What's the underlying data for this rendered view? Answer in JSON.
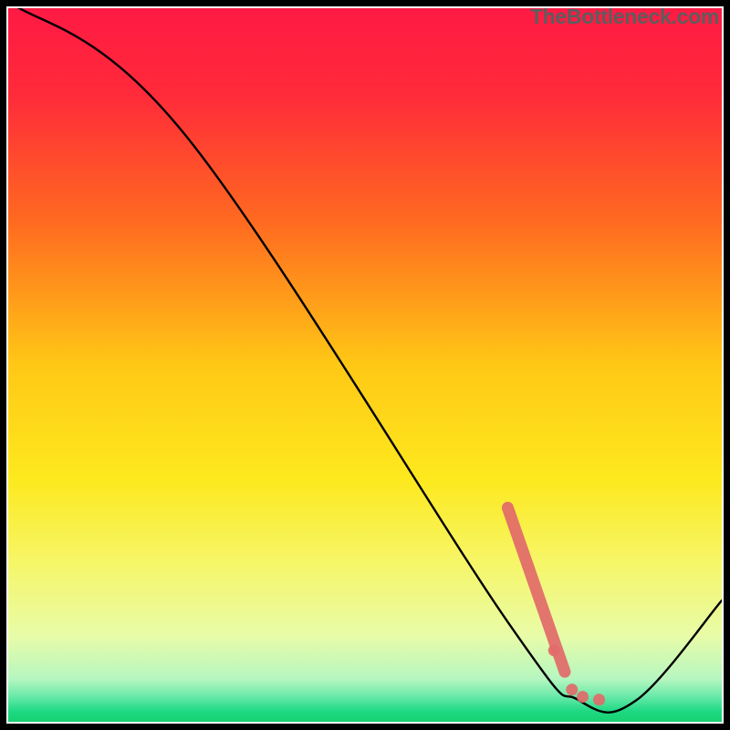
{
  "watermark": "TheBottleneck.com",
  "chart_data": {
    "type": "line",
    "title": "",
    "xlabel": "",
    "ylabel": "",
    "xlim": [
      0,
      100
    ],
    "ylim": [
      0,
      100
    ],
    "curve": [
      {
        "x": 0,
        "y": 101
      },
      {
        "x": 25,
        "y": 82
      },
      {
        "x": 70,
        "y": 14
      },
      {
        "x": 80,
        "y": 3
      },
      {
        "x": 88,
        "y": 3
      },
      {
        "x": 100,
        "y": 17
      }
    ],
    "highlight_segments": [
      {
        "x1": 70,
        "y1": 30,
        "x2": 78,
        "y2": 7
      }
    ],
    "highlight_points": [
      {
        "x": 76.5,
        "y": 10
      },
      {
        "x": 79,
        "y": 4.5
      },
      {
        "x": 80.5,
        "y": 3.5
      },
      {
        "x": 82.8,
        "y": 3.1
      }
    ],
    "gradient_stops": [
      {
        "offset": 0.0,
        "color": "#ff1a44"
      },
      {
        "offset": 0.12,
        "color": "#ff2a3a"
      },
      {
        "offset": 0.3,
        "color": "#ff6a20"
      },
      {
        "offset": 0.5,
        "color": "#ffc815"
      },
      {
        "offset": 0.66,
        "color": "#fde91e"
      },
      {
        "offset": 0.78,
        "color": "#f6f66a"
      },
      {
        "offset": 0.88,
        "color": "#e8fca8"
      },
      {
        "offset": 0.94,
        "color": "#b6f6c0"
      },
      {
        "offset": 0.965,
        "color": "#67e9a8"
      },
      {
        "offset": 0.985,
        "color": "#1fd983"
      },
      {
        "offset": 1.0,
        "color": "#17d172"
      }
    ],
    "highlight_color": "#e26a6a",
    "curve_color": "#000000"
  }
}
